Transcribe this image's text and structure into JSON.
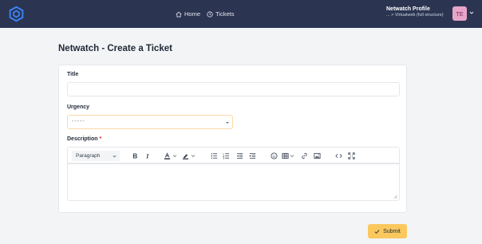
{
  "header": {
    "nav": {
      "home": "Home",
      "tickets": "Tickets"
    },
    "profile": {
      "name": "Netwatch Profile",
      "subtitle": "... > Virtualweb (full structure)",
      "initials": "TE"
    },
    "colors": {
      "background": "#2b3552",
      "avatar": "#e7a5c8"
    }
  },
  "page": {
    "title": "Netwatch - Create a Ticket"
  },
  "form": {
    "title_label": "Title",
    "title_value": "",
    "urgency_label": "Urgency",
    "urgency_value": "-----",
    "description_label": "Description",
    "required_mark": "*",
    "editor": {
      "block_format": "Paragraph",
      "tools": [
        "bold-icon",
        "italic-icon",
        "font-color-icon",
        "highlight-icon",
        "bulleted-list-icon",
        "numbered-list-icon",
        "outdent-icon",
        "indent-icon",
        "emoji-icon",
        "table-icon",
        "link-icon",
        "image-icon",
        "source-code-icon",
        "fullscreen-icon"
      ]
    }
  },
  "actions": {
    "submit_label": "Submit",
    "submit_color": "#fbc85e"
  }
}
